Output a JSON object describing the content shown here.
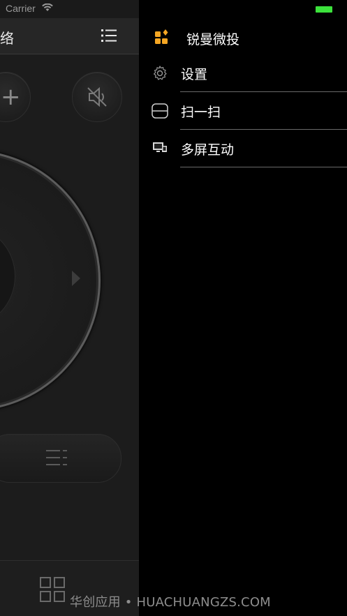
{
  "status_bar": {
    "carrier": "Carrier",
    "wifi_icon": "wifi-icon",
    "battery_icon": "battery-icon",
    "battery_color": "#3ce23c"
  },
  "remote": {
    "title": "络",
    "menu_icon": "list-menu-icon",
    "volume_up_label": "+",
    "mute_icon": "mute-icon",
    "menu_button_icon": "menu-lines-icon",
    "home_icon": "grid-icon"
  },
  "drawer": {
    "app_name": "锐曼微投",
    "app_logo_icon": "app-logo-icon",
    "accent_color": "#f5a623",
    "items": [
      {
        "label": "设置",
        "icon": "gear-icon"
      },
      {
        "label": "扫一扫",
        "icon": "scan-icon"
      },
      {
        "label": "多屏互动",
        "icon": "screen-cast-icon"
      }
    ]
  },
  "watermark": "华创应用 • HUACHUANGZS.COM"
}
